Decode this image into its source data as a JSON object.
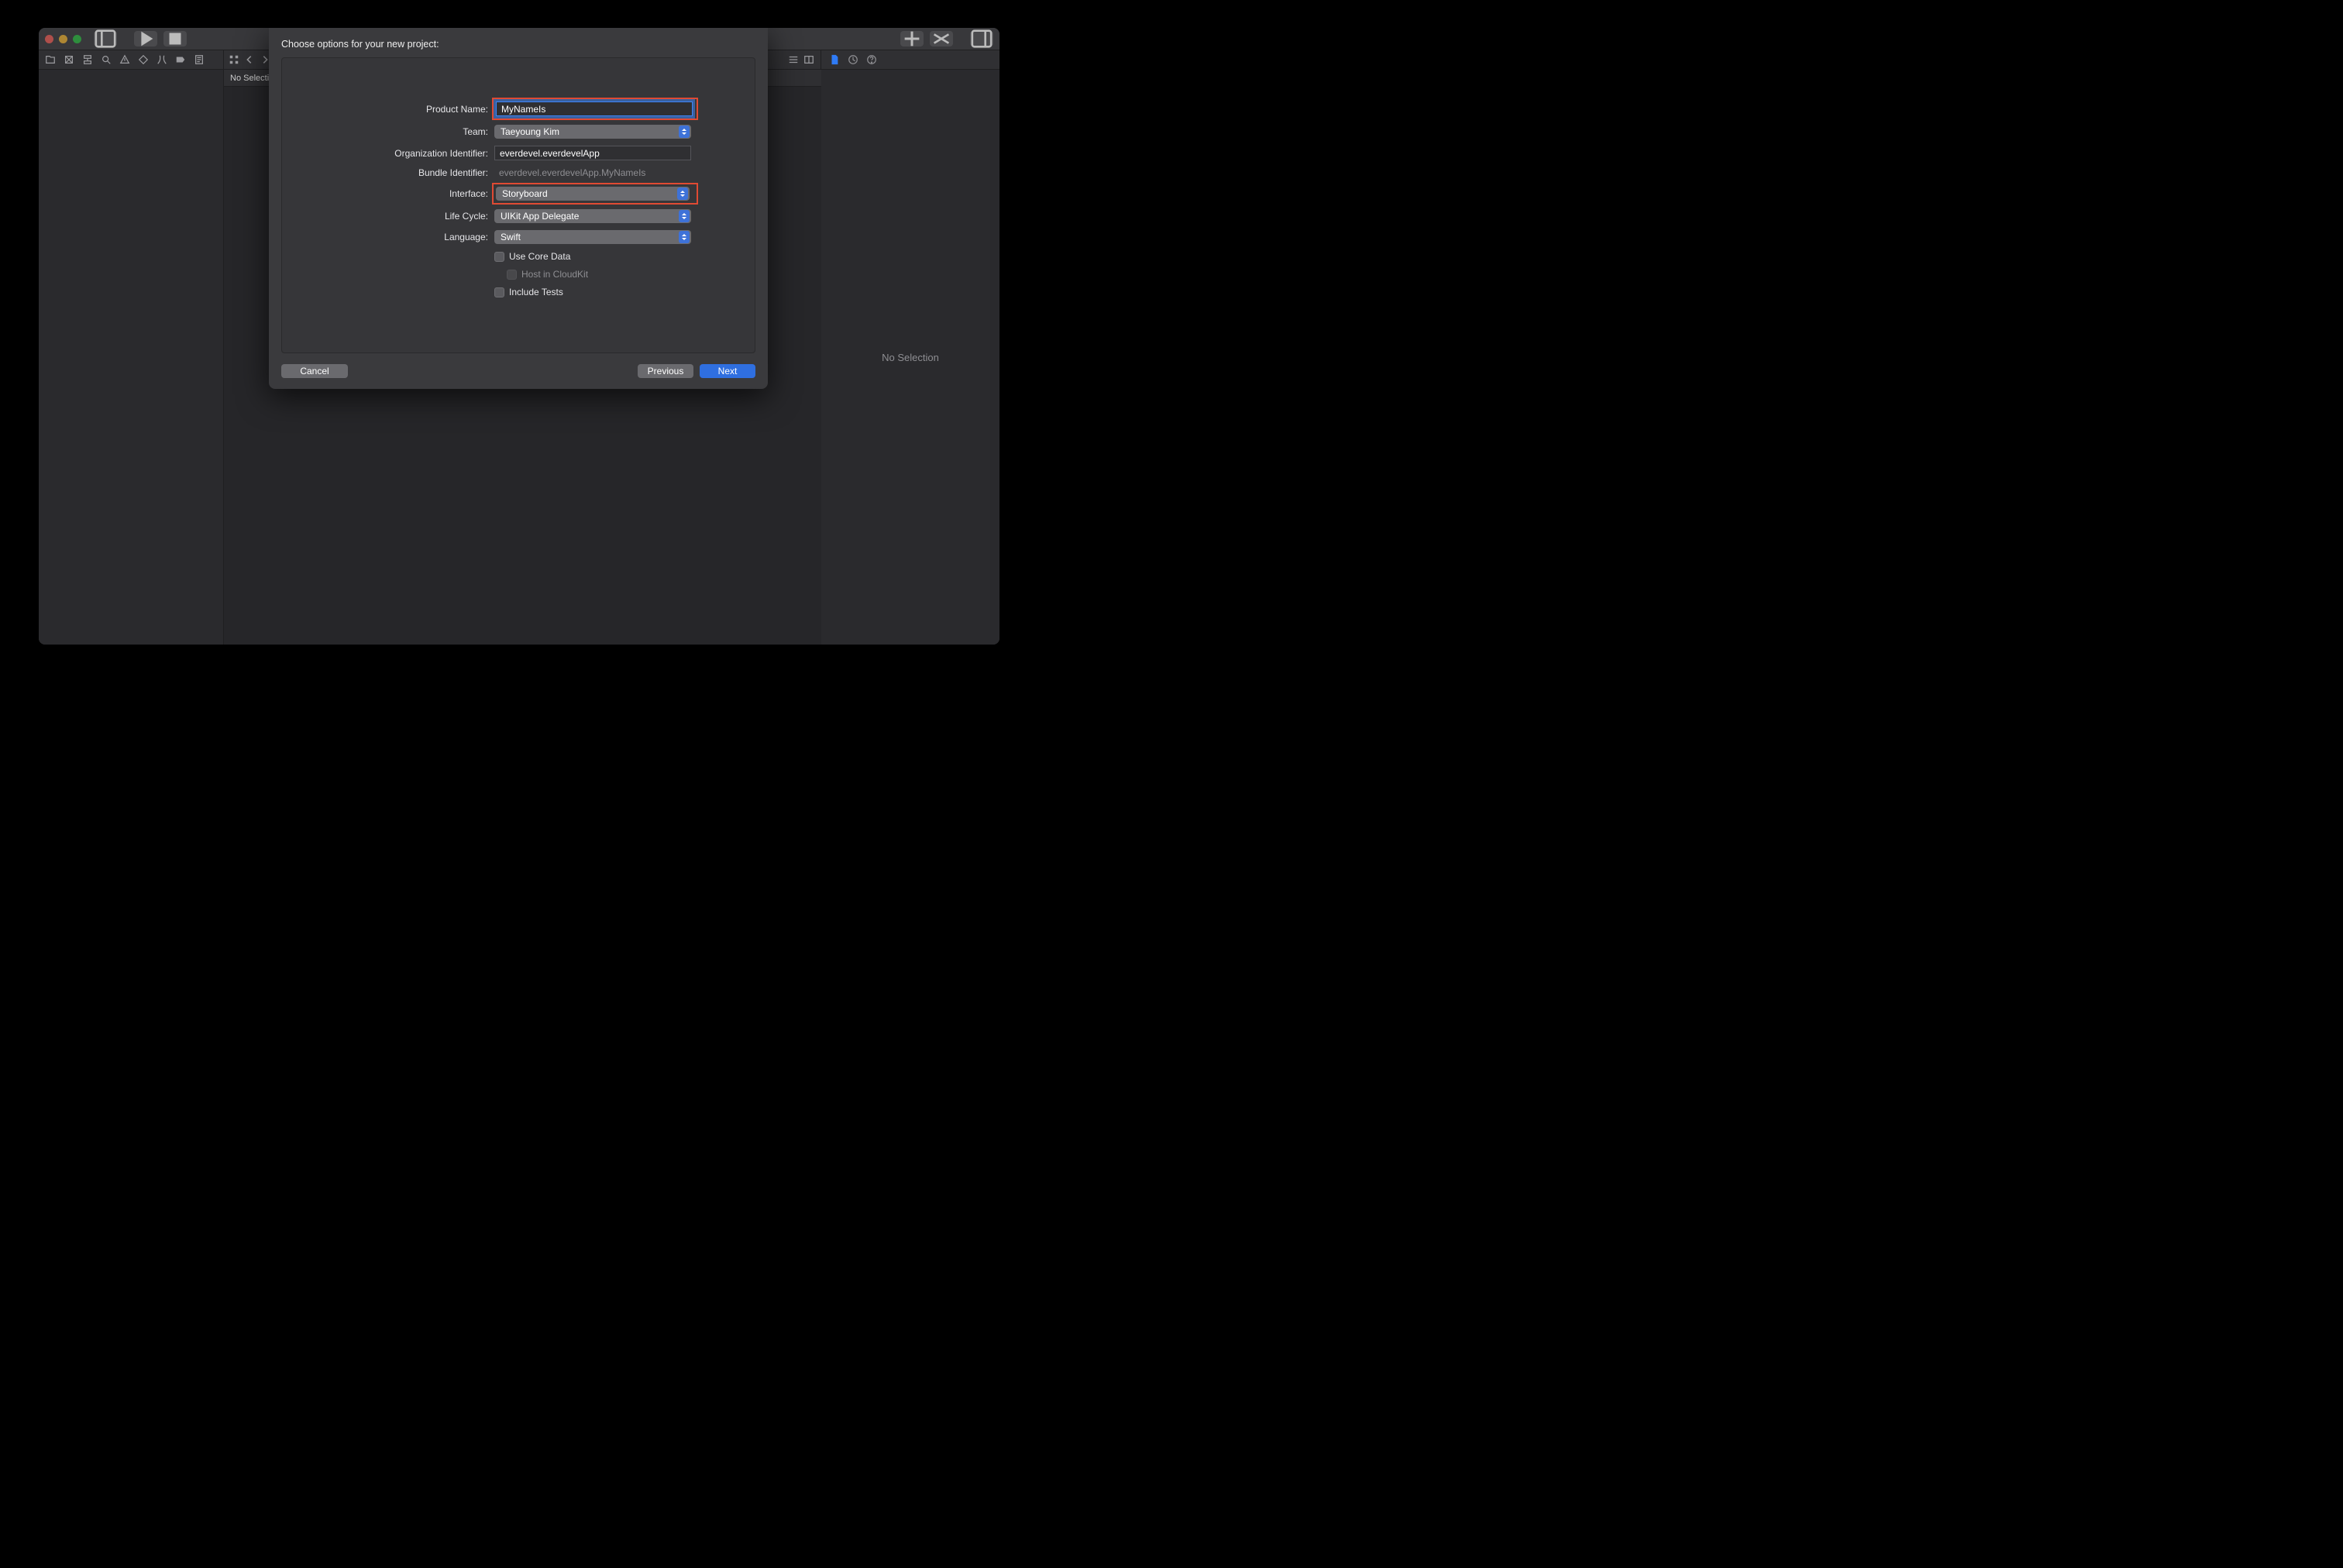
{
  "titlebar": {
    "search_placeholder": ""
  },
  "jump_bar": "No Selection",
  "inspector_placeholder": "No Selection",
  "sheet": {
    "title": "Choose options for your new project:",
    "labels": {
      "product_name": "Product Name:",
      "team": "Team:",
      "org_identifier": "Organization Identifier:",
      "bundle_identifier": "Bundle Identifier:",
      "interface": "Interface:",
      "life_cycle": "Life Cycle:",
      "language": "Language:"
    },
    "values": {
      "product_name": "MyNameIs",
      "team": "Taeyoung Kim",
      "org_identifier": "everdevel.everdevelApp",
      "bundle_identifier": "everdevel.everdevelApp.MyNameIs",
      "interface": "Storyboard",
      "life_cycle": "UIKit App Delegate",
      "language": "Swift"
    },
    "checks": {
      "use_core_data": "Use Core Data",
      "host_cloudkit": "Host in CloudKit",
      "include_tests": "Include Tests"
    },
    "buttons": {
      "cancel": "Cancel",
      "previous": "Previous",
      "next": "Next"
    }
  }
}
